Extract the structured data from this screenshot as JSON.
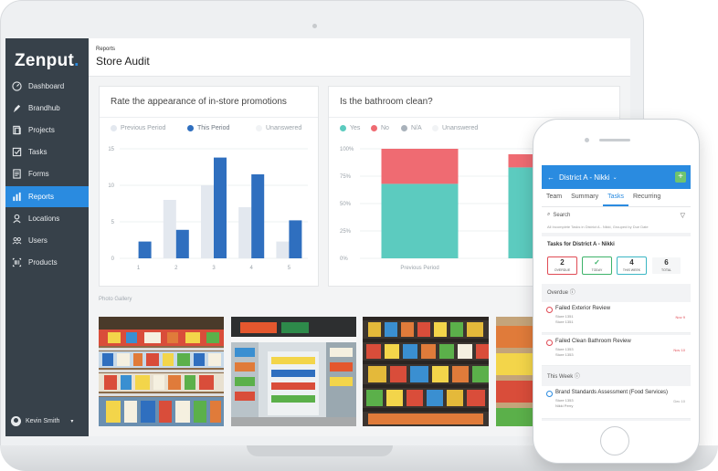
{
  "app": {
    "logo": "Zenput",
    "breadcrumb": "Reports",
    "title": "Store Audit",
    "accent": "#2a8be0"
  },
  "sidebar": {
    "items": [
      {
        "label": "Dashboard",
        "icon": "gauge-icon"
      },
      {
        "label": "Brandhub",
        "icon": "brandhub-icon"
      },
      {
        "label": "Projects",
        "icon": "projects-icon"
      },
      {
        "label": "Tasks",
        "icon": "tasks-icon"
      },
      {
        "label": "Forms",
        "icon": "forms-icon"
      },
      {
        "label": "Reports",
        "icon": "reports-icon",
        "active": true
      },
      {
        "label": "Locations",
        "icon": "locations-icon"
      },
      {
        "label": "Users",
        "icon": "users-icon"
      },
      {
        "label": "Products",
        "icon": "products-icon"
      }
    ],
    "user": "Kevin Smith"
  },
  "cards": {
    "promotions": {
      "title": "Rate the appearance of in-store promotions",
      "legend": [
        "Previous Period",
        "This Period",
        "Unanswered"
      ]
    },
    "bathroom": {
      "title": "Is the bathroom clean?",
      "legend": [
        "Yes",
        "No",
        "N/A",
        "Unanswered"
      ]
    }
  },
  "chart_data": [
    {
      "type": "bar",
      "title": "Rate the appearance of in-store promotions",
      "categories": [
        "1",
        "2",
        "3",
        "4",
        "5"
      ],
      "series": [
        {
          "name": "Previous Period",
          "values": [
            0,
            8,
            10,
            7,
            2.3
          ],
          "color": "#e3e8ef"
        },
        {
          "name": "This Period",
          "values": [
            2.3,
            3.9,
            13.8,
            11.5,
            5.2
          ],
          "color": "#2f6fbf"
        }
      ],
      "yticks": [
        0,
        5,
        10,
        15
      ],
      "ylim": [
        0,
        15
      ]
    },
    {
      "type": "bar",
      "stacked": true,
      "title": "Is the bathroom clean?",
      "categories": [
        "Previous Period",
        "This Period"
      ],
      "series": [
        {
          "name": "Yes",
          "values": [
            68,
            83
          ],
          "color": "#5ccbbf"
        },
        {
          "name": "No",
          "values": [
            32,
            12
          ],
          "color": "#ef6b72"
        }
      ],
      "yticks": [
        "0%",
        "25%",
        "50%",
        "75%",
        "100%"
      ],
      "ylim": [
        0,
        100
      ]
    }
  ],
  "gallery": {
    "label": "Photo Gallery"
  },
  "phone": {
    "app_title": "District A - Nikki",
    "tabs": [
      "Team",
      "Summary",
      "Tasks",
      "Recurring"
    ],
    "search_label": "Search",
    "search_note": "All Incomplete Tasks in District A - Nikki, Grouped by Due Date",
    "tasks_for": "Tasks for District A - Nikki",
    "counts": [
      {
        "num": "2",
        "label": "OVERDUE"
      },
      {
        "num": "✓",
        "label": "TODAY"
      },
      {
        "num": "4",
        "label": "THIS WEEK"
      },
      {
        "num": "6",
        "label": "TOTAL"
      }
    ],
    "overdue_label": "Overdue",
    "this_week_label": "This Week",
    "tasks": [
      {
        "title": "Failed Exterior Review",
        "sub1": "Store 1351",
        "sub2": "Store 1351",
        "date": "Nov 9"
      },
      {
        "title": "Failed Clean Bathroom Review",
        "sub1": "Store 1353",
        "sub2": "Store 1353",
        "date": "Nov 10"
      },
      {
        "title": "Brand Standards Assessment (Food Services)",
        "sub1": "Store 1353",
        "sub2": "Nikki Perry",
        "date": "Dec 10"
      }
    ]
  }
}
